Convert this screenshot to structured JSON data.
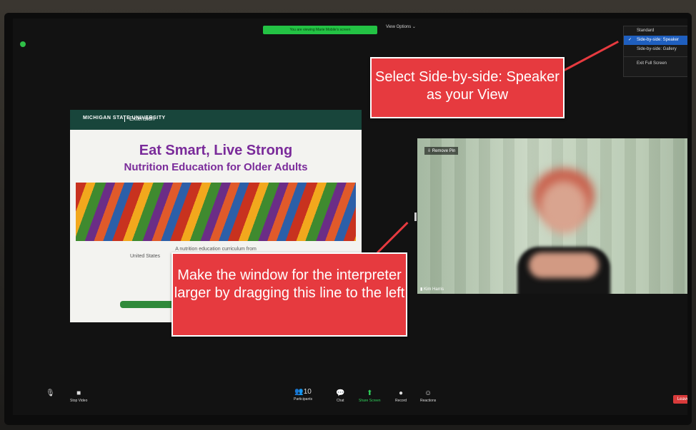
{
  "zoom": {
    "share_banner": "You are viewing Marie Mobile's screen",
    "view_options_label": "View Options",
    "view_menu": {
      "items": [
        {
          "label": "Standard",
          "selected": false
        },
        {
          "label": "Side-by-side: Speaker",
          "selected": true
        },
        {
          "label": "Side-by-side: Gallery",
          "selected": false
        }
      ],
      "exit_label": "Exit Full Screen"
    },
    "slide": {
      "logo_text": "MICHIGAN STATE UNIVERSITY",
      "header_label": "Extension",
      "title": "Eat Smart, Live Strong",
      "subtitle": "Nutrition Education for Older Adults",
      "text_line1": "A nutrition education curriculum from",
      "text_line2": "United States"
    },
    "video": {
      "remove_pin": "Remove Pin",
      "participant_name": "Kim Harris"
    },
    "toolbar": {
      "stop_video": "Stop Video",
      "participants_count": "10",
      "participants": "Participants",
      "chat": "Chat",
      "share_screen": "Share Screen",
      "record": "Record",
      "reactions": "Reactions",
      "leave": "Leave"
    }
  },
  "annotations": {
    "callout_top": "Select Side-by-side: Speaker as your View",
    "callout_bottom": "Make the window for the interpreter larger by dragging this line to the left"
  },
  "colors": {
    "callout": "#e63a3f",
    "msu_green": "#18453b",
    "title_purple": "#7a2b9a",
    "share_green": "#23c244"
  }
}
